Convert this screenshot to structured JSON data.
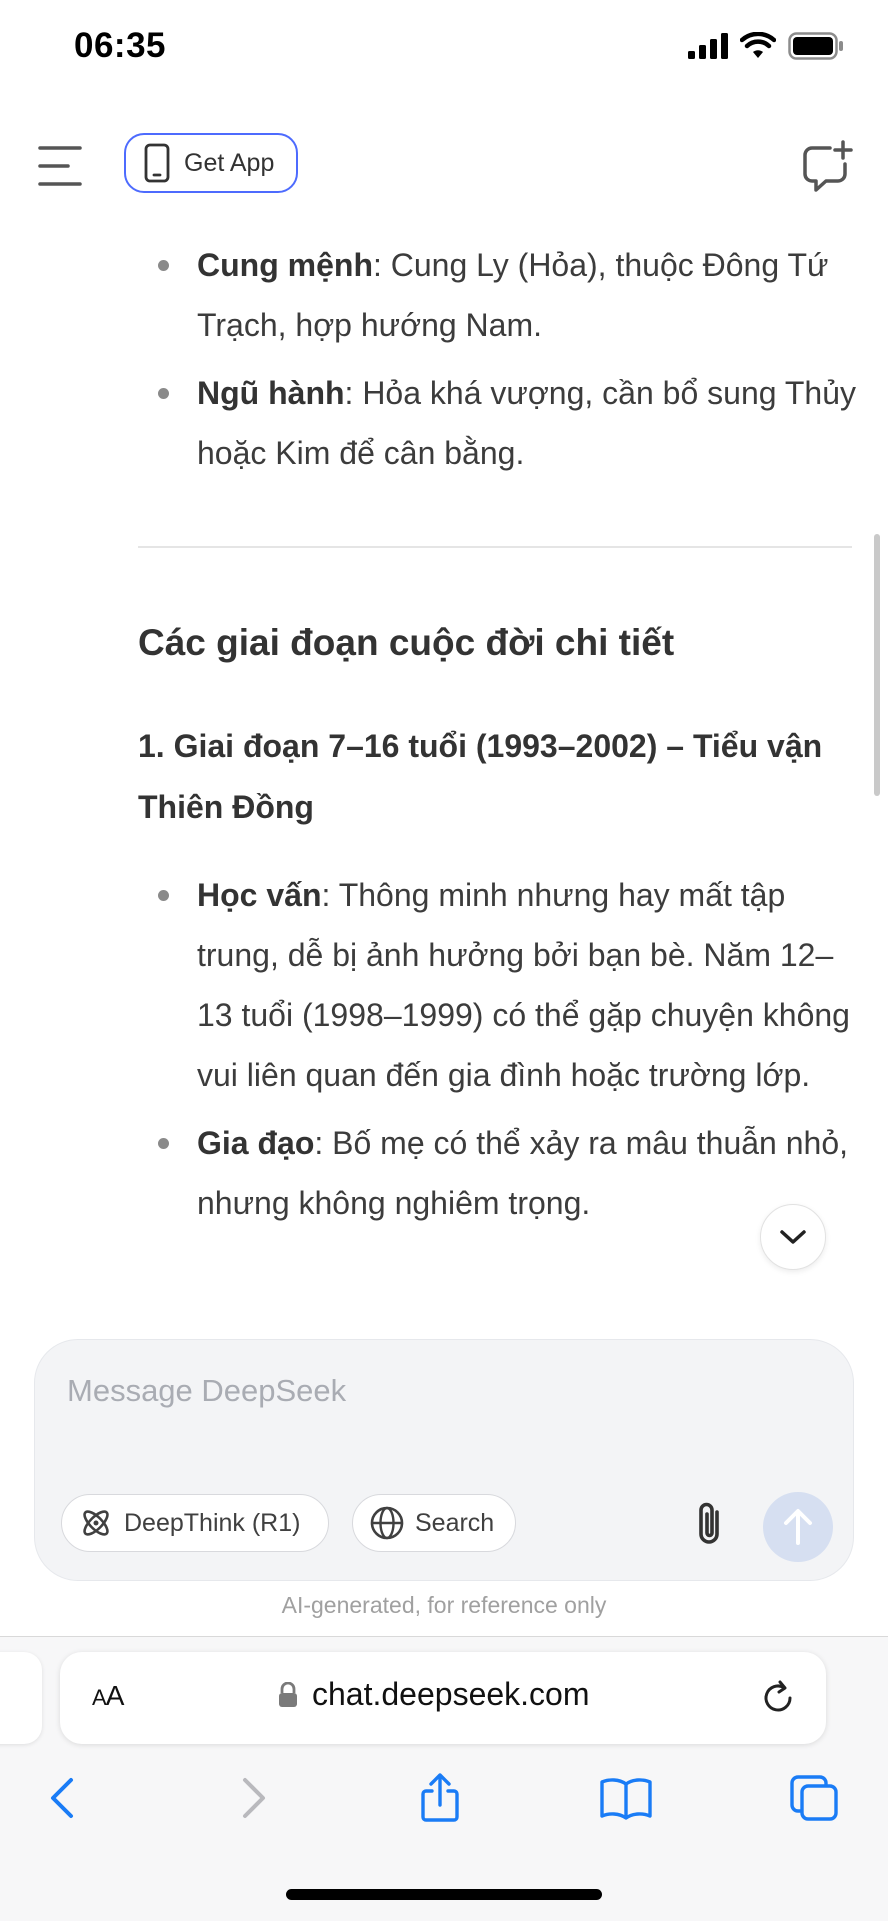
{
  "status_bar": {
    "time": "06:35"
  },
  "header": {
    "get_app_label": "Get App"
  },
  "content": {
    "bullets_top": [
      {
        "term": "Cung mệnh",
        "text": ": Cung Ly (Hỏa), thuộc Đông Tứ Trạch, hợp hướng Nam."
      },
      {
        "term": "Ngũ hành",
        "text": ": Hỏa khá vượng, cần bổ sung Thủy hoặc Kim để cân bằng."
      }
    ],
    "section_title": "Các giai đoạn cuộc đời chi tiết",
    "sub_title": "1. Giai đoạn 7–16 tuổi (1993–2002) – Tiểu vận Thiên Đồng",
    "bullets_bottom": [
      {
        "term": "Học vấn",
        "text": ": Thông minh nhưng hay mất tập trung, dễ bị ảnh hưởng bởi bạn bè. Năm 12–13 tuổi (1998–1999) có thể gặp chuyện không vui liên quan đến gia đình hoặc trường lớp."
      },
      {
        "term": "Gia đạo",
        "text": ": Bố mẹ có thể xảy ra mâu thuẫn nhỏ, nhưng không nghiêm trọng."
      }
    ]
  },
  "composer": {
    "placeholder": "Message DeepSeek",
    "deepthink_label": "DeepThink (R1)",
    "search_label": "Search"
  },
  "disclaimer": "AI-generated, for reference only",
  "browser": {
    "aa_label": "AA",
    "url": "chat.deepseek.com"
  },
  "colors": {
    "accent": "#4d6bfe",
    "send_disabled": "#d6dff1",
    "safari_blue": "#1a7cf6"
  },
  "icons": [
    "menu-icon",
    "phone-icon",
    "new-chat-icon",
    "chevron-down-icon",
    "deepthink-icon",
    "globe-icon",
    "paperclip-icon",
    "arrow-up-icon",
    "lock-icon",
    "reload-icon",
    "back-icon",
    "forward-icon",
    "share-icon",
    "bookmarks-icon",
    "tabs-icon"
  ]
}
